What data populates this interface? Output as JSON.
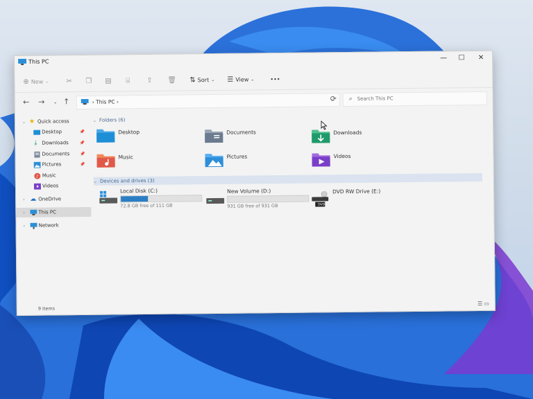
{
  "window": {
    "title": "This PC"
  },
  "toolbar": {
    "new_label": "New",
    "sort_label": "Sort",
    "view_label": "View",
    "more_label": "•••"
  },
  "address": {
    "crumb": "This PC"
  },
  "search": {
    "placeholder": "Search This PC"
  },
  "navpane": {
    "quick_access": "Quick access",
    "items": [
      {
        "label": "Desktop"
      },
      {
        "label": "Downloads"
      },
      {
        "label": "Documents"
      },
      {
        "label": "Pictures"
      },
      {
        "label": "Music"
      },
      {
        "label": "Videos"
      }
    ],
    "onedrive": "OneDrive",
    "thispc": "This PC",
    "network": "Network"
  },
  "folders": {
    "header": "Folders (6)",
    "items": [
      {
        "label": "Desktop",
        "icon": "desktop-folder-icon",
        "color": "#1e8fd6"
      },
      {
        "label": "Documents",
        "icon": "documents-folder-icon",
        "color": "#6b7a8f"
      },
      {
        "label": "Downloads",
        "icon": "downloads-folder-icon",
        "color": "#1f9a6b"
      },
      {
        "label": "Music",
        "icon": "music-folder-icon",
        "color": "#e0594a"
      },
      {
        "label": "Pictures",
        "icon": "pictures-folder-icon",
        "color": "#2d8fd8"
      },
      {
        "label": "Videos",
        "icon": "videos-folder-icon",
        "color": "#7a3fc8"
      }
    ]
  },
  "drives": {
    "header": "Devices and drives (3)",
    "items": [
      {
        "label": "Local Disk (C:)",
        "free": "72.8 GB free of 111 GB",
        "used_fraction": 0.34
      },
      {
        "label": "New Volume (D:)",
        "free": "931 GB free of 931 GB",
        "used_fraction": 0.0
      },
      {
        "label": "DVD RW Drive (E:)",
        "badge": "DVD"
      }
    ]
  },
  "status": {
    "count": "9 items"
  },
  "colors": {
    "accent": "#2b7ec4",
    "window_bg": "#f3f3f3",
    "wallpaper": "#1a6fe0"
  }
}
